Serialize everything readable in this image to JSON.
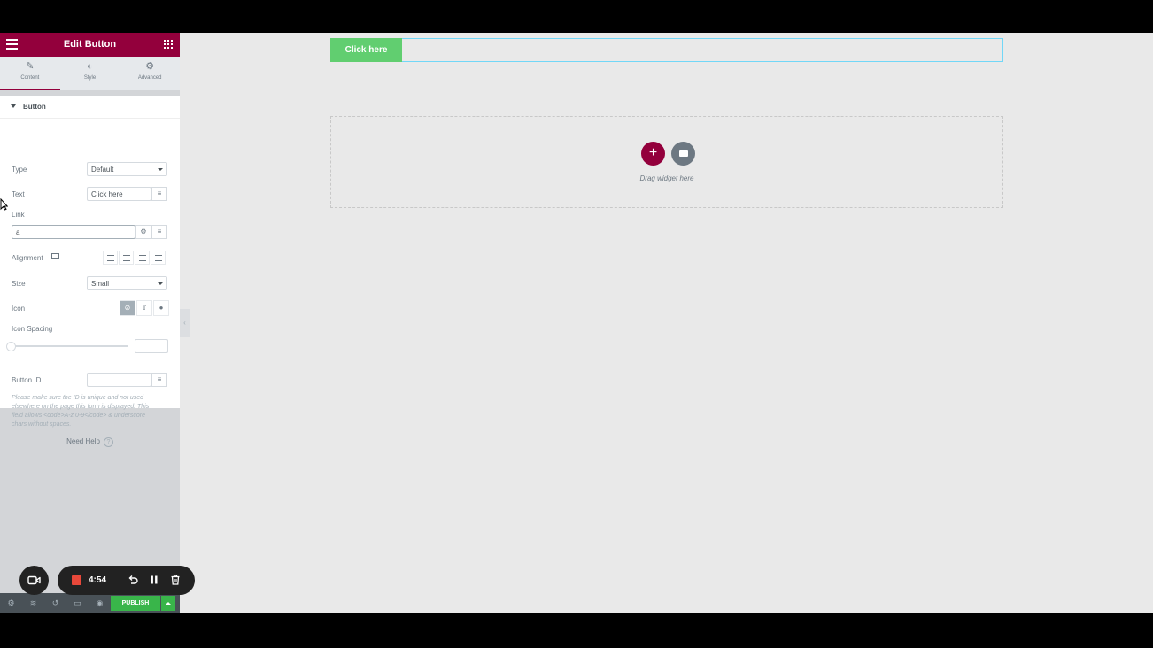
{
  "panel": {
    "header_title": "Edit Button",
    "tabs": [
      {
        "label": "Content",
        "icon": "pencil-icon"
      },
      {
        "label": "Style",
        "icon": "half-circle-icon"
      },
      {
        "label": "Advanced",
        "icon": "gear-icon"
      }
    ],
    "section_title": "Button",
    "type": {
      "label": "Type",
      "value": "Default"
    },
    "text": {
      "label": "Text",
      "value": "Click here"
    },
    "link": {
      "label": "Link",
      "value": "a"
    },
    "alignment": {
      "label": "Alignment"
    },
    "size": {
      "label": "Size",
      "value": "Small"
    },
    "icon": {
      "label": "Icon"
    },
    "icon_spacing": {
      "label": "Icon Spacing",
      "value": ""
    },
    "button_id": {
      "label": "Button ID",
      "value": ""
    },
    "help_text": "Please make sure the ID is unique and not used elsewhere on the page this form is displayed. This field allows <code>A-z 0-9</code> & underscore chars without spaces.",
    "need_help": "Need Help",
    "publish_label": "PUBLISH"
  },
  "recorder": {
    "time": "4:54"
  },
  "canvas": {
    "button_text": "Click here",
    "drop_text": "Drag widget here"
  },
  "colors": {
    "brand": "#93003c",
    "button_green": "#61ce70",
    "publish_green": "#39b54a"
  }
}
